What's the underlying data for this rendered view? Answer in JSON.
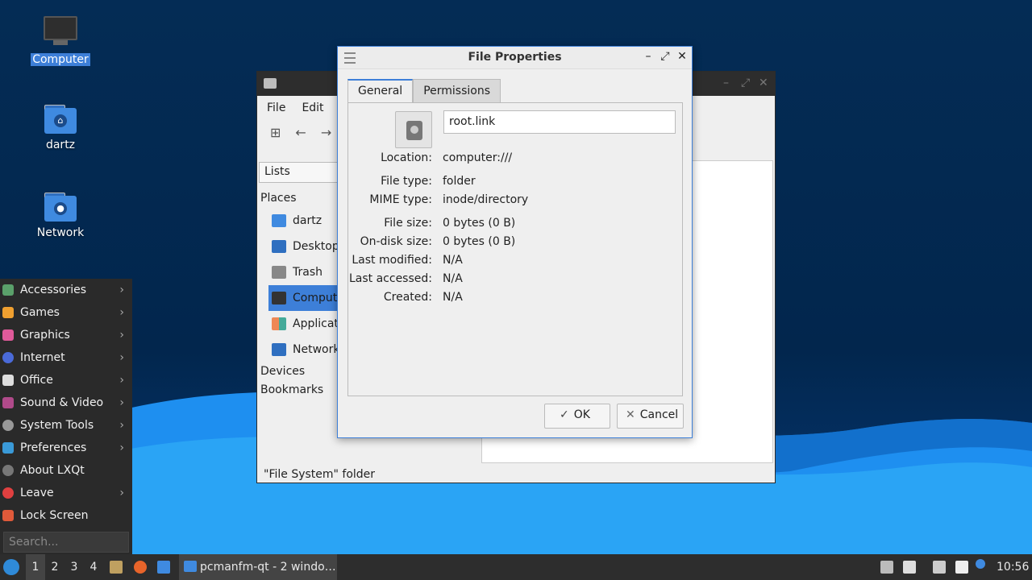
{
  "desktop": {
    "icons": [
      {
        "label": "Computer"
      },
      {
        "label": "dartz"
      },
      {
        "label": "Network"
      }
    ]
  },
  "filemanager": {
    "menu": [
      "File",
      "Edit"
    ],
    "lists_label": "Lists",
    "places_header": "Places",
    "places": [
      "dartz",
      "Desktop",
      "Trash",
      "Computer",
      "Applications",
      "Network"
    ],
    "devices_header": "Devices",
    "bookmarks_header": "Bookmarks",
    "status": "\"File System\" folder"
  },
  "dialog": {
    "title": "File Properties",
    "tabs": [
      "General",
      "Permissions"
    ],
    "filename": "root.link",
    "props": [
      {
        "k": "Location:",
        "v": "computer:///"
      },
      {
        "k": "File type:",
        "v": "folder"
      },
      {
        "k": "MIME type:",
        "v": "inode/directory"
      },
      {
        "k": "File size:",
        "v": "0 bytes (0 B)"
      },
      {
        "k": "On-disk size:",
        "v": "0 bytes (0 B)"
      },
      {
        "k": "Last modified:",
        "v": "N/A"
      },
      {
        "k": "Last accessed:",
        "v": "N/A"
      },
      {
        "k": "Created:",
        "v": "N/A"
      }
    ],
    "ok_label": "OK",
    "cancel_label": "Cancel"
  },
  "startmenu": {
    "items": [
      "Accessories",
      "Games",
      "Graphics",
      "Internet",
      "Office",
      "Sound & Video",
      "System Tools",
      "Preferences",
      "About LXQt",
      "Leave",
      "Lock Screen"
    ],
    "search_placeholder": "Search..."
  },
  "taskbar": {
    "workspaces": [
      "1",
      "2",
      "3",
      "4"
    ],
    "task_label": "pcmanfm-qt - 2 windo…",
    "clock": "10:56"
  },
  "colors": {
    "accent": "#3d7fd8",
    "desktop_bg": "#02264d",
    "wave": "#1e8ff0"
  }
}
